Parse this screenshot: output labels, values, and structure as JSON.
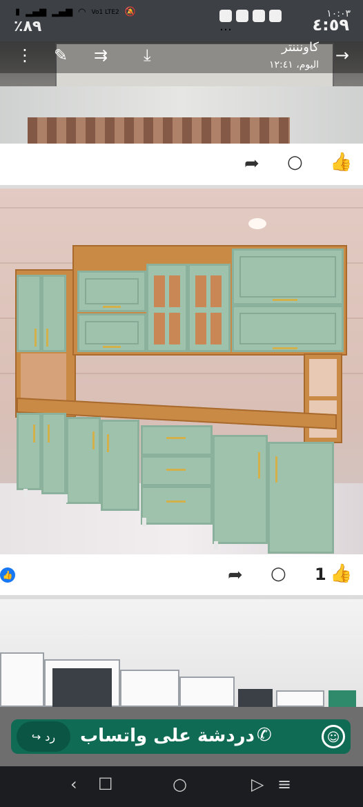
{
  "status_bar": {
    "time_top": "١٠:٠٣",
    "time": "٤:٥٩",
    "battery_pct": "٪٨٩",
    "signal": "Vo1 LTE2",
    "more": "…"
  },
  "post1_overlay": {
    "title": "كاونننتر",
    "subtitle": "اليوم، ١٢:٤١"
  },
  "post2_actions": {
    "like_count": "1"
  },
  "chat_bar": {
    "label": "دردشة على واتساب",
    "reply_label": "رد"
  },
  "colors": {
    "accent_green": "#0f6b54",
    "cabinet_mint": "#9fc2ad",
    "wood": "#c98a45",
    "facebook_blue": "#1877f2"
  },
  "icons": {
    "overlay": [
      "more-vert-icon",
      "edit-icon",
      "forward-icon",
      "download-icon",
      "arrow-right-icon"
    ],
    "actions": [
      "share-icon",
      "comment-icon",
      "like-icon"
    ],
    "nav": [
      "back-icon",
      "recents-icon",
      "home-icon",
      "assistant-icon",
      "menu-icon"
    ]
  }
}
